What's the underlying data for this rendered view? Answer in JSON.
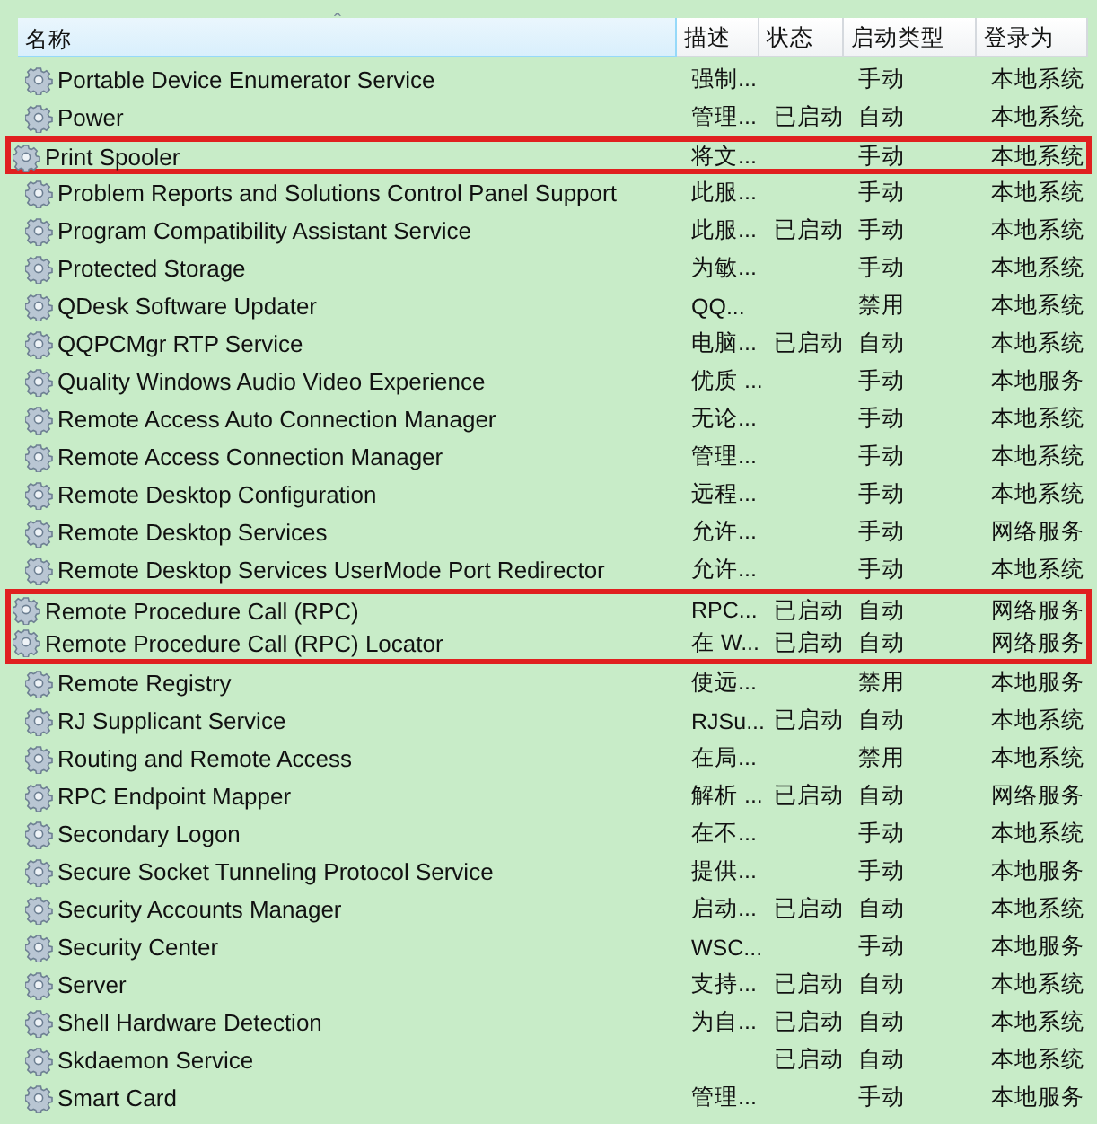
{
  "table": {
    "columns": [
      {
        "label": "名称",
        "sorted": true
      },
      {
        "label": "描述",
        "sorted": false
      },
      {
        "label": "状态",
        "sorted": false
      },
      {
        "label": "启动类型",
        "sorted": false
      },
      {
        "label": "登录为",
        "sorted": false
      }
    ],
    "sort_indicator": "ˆ",
    "rows": [
      {
        "name": "Portable Device Enumerator Service",
        "description": "强制...",
        "status": "",
        "startup": "手动",
        "logon": "本地系统",
        "highlighted": false
      },
      {
        "name": "Power",
        "description": "管理...",
        "status": "已启动",
        "startup": "自动",
        "logon": "本地系统",
        "highlighted": false
      },
      {
        "name": "Print Spooler",
        "description": "将文...",
        "status": "",
        "startup": "手动",
        "logon": "本地系统",
        "highlighted": true
      },
      {
        "name": "Problem Reports and Solutions Control Panel Support",
        "description": "此服...",
        "status": "",
        "startup": "手动",
        "logon": "本地系统",
        "highlighted": false
      },
      {
        "name": "Program Compatibility Assistant Service",
        "description": "此服...",
        "status": "已启动",
        "startup": "手动",
        "logon": "本地系统",
        "highlighted": false
      },
      {
        "name": "Protected Storage",
        "description": "为敏...",
        "status": "",
        "startup": "手动",
        "logon": "本地系统",
        "highlighted": false
      },
      {
        "name": "QDesk Software Updater",
        "description": "QQ...",
        "status": "",
        "startup": "禁用",
        "logon": "本地系统",
        "highlighted": false
      },
      {
        "name": "QQPCMgr RTP Service",
        "description": "电脑...",
        "status": "已启动",
        "startup": "自动",
        "logon": "本地系统",
        "highlighted": false
      },
      {
        "name": "Quality Windows Audio Video Experience",
        "description": "优质 ...",
        "status": "",
        "startup": "手动",
        "logon": "本地服务",
        "highlighted": false
      },
      {
        "name": "Remote Access Auto Connection Manager",
        "description": "无论...",
        "status": "",
        "startup": "手动",
        "logon": "本地系统",
        "highlighted": false
      },
      {
        "name": "Remote Access Connection Manager",
        "description": "管理...",
        "status": "",
        "startup": "手动",
        "logon": "本地系统",
        "highlighted": false
      },
      {
        "name": "Remote Desktop Configuration",
        "description": "远程...",
        "status": "",
        "startup": "手动",
        "logon": "本地系统",
        "highlighted": false
      },
      {
        "name": "Remote Desktop Services",
        "description": "允许...",
        "status": "",
        "startup": "手动",
        "logon": "网络服务",
        "highlighted": false
      },
      {
        "name": "Remote Desktop Services UserMode Port Redirector",
        "description": "允许...",
        "status": "",
        "startup": "手动",
        "logon": "本地系统",
        "highlighted": false
      },
      {
        "name": "Remote Procedure Call (RPC)",
        "description": "RPC...",
        "status": "已启动",
        "startup": "自动",
        "logon": "网络服务",
        "highlighted": true
      },
      {
        "name": "Remote Procedure Call (RPC) Locator",
        "description": "在 W...",
        "status": "已启动",
        "startup": "自动",
        "logon": "网络服务",
        "highlighted": true
      },
      {
        "name": "Remote Registry",
        "description": "使远...",
        "status": "",
        "startup": "禁用",
        "logon": "本地服务",
        "highlighted": false
      },
      {
        "name": "RJ Supplicant Service",
        "description": "RJSu...",
        "status": "已启动",
        "startup": "自动",
        "logon": "本地系统",
        "highlighted": false
      },
      {
        "name": "Routing and Remote Access",
        "description": "在局...",
        "status": "",
        "startup": "禁用",
        "logon": "本地系统",
        "highlighted": false
      },
      {
        "name": "RPC Endpoint Mapper",
        "description": "解析 ...",
        "status": "已启动",
        "startup": "自动",
        "logon": "网络服务",
        "highlighted": false
      },
      {
        "name": "Secondary Logon",
        "description": "在不...",
        "status": "",
        "startup": "手动",
        "logon": "本地系统",
        "highlighted": false
      },
      {
        "name": "Secure Socket Tunneling Protocol Service",
        "description": "提供...",
        "status": "",
        "startup": "手动",
        "logon": "本地服务",
        "highlighted": false
      },
      {
        "name": "Security Accounts Manager",
        "description": "启动...",
        "status": "已启动",
        "startup": "自动",
        "logon": "本地系统",
        "highlighted": false
      },
      {
        "name": "Security Center",
        "description": "WSC...",
        "status": "",
        "startup": "手动",
        "logon": "本地服务",
        "highlighted": false
      },
      {
        "name": "Server",
        "description": "支持...",
        "status": "已启动",
        "startup": "自动",
        "logon": "本地系统",
        "highlighted": false
      },
      {
        "name": "Shell Hardware Detection",
        "description": "为自...",
        "status": "已启动",
        "startup": "自动",
        "logon": "本地系统",
        "highlighted": false
      },
      {
        "name": "Skdaemon Service",
        "description": "",
        "status": "已启动",
        "startup": "自动",
        "logon": "本地系统",
        "highlighted": false
      },
      {
        "name": "Smart Card",
        "description": "管理...",
        "status": "",
        "startup": "手动",
        "logon": "本地服务",
        "highlighted": false
      }
    ]
  }
}
